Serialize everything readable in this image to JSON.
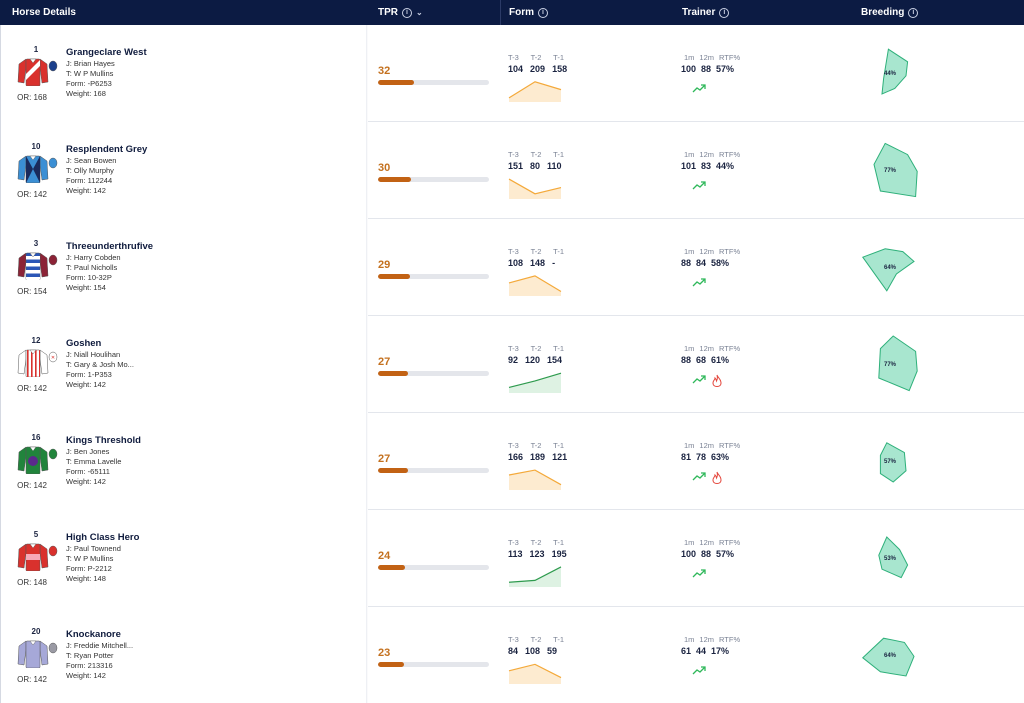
{
  "header": {
    "horse_details": "Horse Details",
    "tpr": "TPR",
    "form": "Form",
    "trainer": "Trainer",
    "breeding": "Breeding",
    "info_icon": "info-icon",
    "sort_icon": "chevron-down-icon"
  },
  "labels": {
    "form_t3": "T-3",
    "form_t2": "T-2",
    "form_t1": "T-1",
    "tr_1m": "1m",
    "tr_12m": "12m",
    "tr_rtf": "RTF%"
  },
  "colors": {
    "header_bg": "#0c1b43",
    "tpr_text": "#c4711f",
    "tpr_bar": "#c26214",
    "form_down": "#f4a93a",
    "form_up": "#2e9b4e",
    "trend": "#2fb85a",
    "hot": "#e4463c",
    "breeding_fill": "#a8e6cf",
    "breeding_stroke": "#2eb07a"
  },
  "horses": [
    {
      "number": "1",
      "name": "Grangeclare West",
      "jockey": "J: Brian Hayes",
      "trainer": "T: W P Mullins",
      "form_str": "Form: -P6253",
      "weight": "Weight: 168",
      "or": "OR: 168",
      "tpr": "32",
      "tpr_pct": 32,
      "form": {
        "t3": "104",
        "t2": "209",
        "t1": "158",
        "trend": "down",
        "series": [
          104,
          209,
          158
        ]
      },
      "trainer_stats": {
        "m1": "100",
        "m12": "88",
        "rtf": "57%",
        "hot": false
      },
      "breeding": {
        "pct": "44%",
        "shape": [
          [
            -0.05,
            -0.85
          ],
          [
            0.55,
            -0.4
          ],
          [
            0.5,
            0.1
          ],
          [
            0.15,
            0.55
          ],
          [
            -0.25,
            0.75
          ],
          [
            -0.2,
            0.2
          ]
        ]
      },
      "silks": {
        "body": "#d9312d",
        "sleeve": "#d9312d",
        "cap": "#1b3f8b",
        "pattern": "sash",
        "pattern_color": "#ffffff"
      }
    },
    {
      "number": "10",
      "name": "Resplendent Grey",
      "jockey": "J: Sean Bowen",
      "trainer": "T: Olly Murphy",
      "form_str": "Form: 112244",
      "weight": "Weight: 142",
      "or": "OR: 142",
      "tpr": "30",
      "tpr_pct": 30,
      "form": {
        "t3": "151",
        "t2": "80",
        "t1": "110",
        "trend": "down",
        "series": [
          151,
          80,
          110
        ]
      },
      "trainer_stats": {
        "m1": "101",
        "m12": "83",
        "rtf": "44%",
        "hot": false
      },
      "breeding": {
        "pct": "77%",
        "shape": [
          [
            -0.15,
            -0.95
          ],
          [
            0.55,
            -0.55
          ],
          [
            0.85,
            0.05
          ],
          [
            0.8,
            0.95
          ],
          [
            -0.3,
            0.75
          ],
          [
            -0.5,
            -0.2
          ]
        ]
      },
      "silks": {
        "body": "#3b8fd4",
        "sleeve": "#3b8fd4",
        "cap": "#3b8fd4",
        "pattern": "diamond",
        "pattern_color": "#1a2b5c"
      }
    },
    {
      "number": "3",
      "name": "Threeunderthrufive",
      "jockey": "J: Harry Cobden",
      "trainer": "T: Paul Nicholls",
      "form_str": "Form: 10-32P",
      "weight": "Weight: 154",
      "or": "OR: 154",
      "tpr": "29",
      "tpr_pct": 29,
      "form": {
        "t3": "108",
        "t2": "148",
        "t1": "-",
        "trend": "down",
        "series": [
          108,
          148,
          60
        ]
      },
      "trainer_stats": {
        "m1": "88",
        "m12": "84",
        "rtf": "58%",
        "hot": false
      },
      "breeding": {
        "pct": "64%",
        "shape": [
          [
            -0.85,
            -0.35
          ],
          [
            -0.15,
            -0.65
          ],
          [
            0.4,
            -0.55
          ],
          [
            0.75,
            -0.2
          ],
          [
            0.2,
            0.25
          ],
          [
            -0.1,
            0.85
          ]
        ]
      },
      "silks": {
        "body": "#2b56b7",
        "sleeve": "#8b2336",
        "cap": "#8b2336",
        "pattern": "hoops",
        "pattern_color": "#ffffff"
      }
    },
    {
      "number": "12",
      "name": "Goshen",
      "jockey": "J: Niall Houlihan",
      "trainer": "T: Gary & Josh Mo...",
      "form_str": "Form: 1-P353",
      "weight": "Weight: 142",
      "or": "OR: 142",
      "tpr": "27",
      "tpr_pct": 27,
      "form": {
        "t3": "92",
        "t2": "120",
        "t1": "154",
        "trend": "up",
        "series": [
          92,
          120,
          154
        ]
      },
      "trainer_stats": {
        "m1": "88",
        "m12": "68",
        "rtf": "61%",
        "hot": true
      },
      "breeding": {
        "pct": "77%",
        "shape": [
          [
            -0.3,
            -0.55
          ],
          [
            0.1,
            -1.0
          ],
          [
            0.8,
            -0.45
          ],
          [
            0.85,
            0.25
          ],
          [
            0.6,
            0.95
          ],
          [
            -0.35,
            0.5
          ]
        ]
      },
      "silks": {
        "body": "#ffffff",
        "sleeve": "#ffffff",
        "cap": "#ffffff",
        "pattern": "stripes",
        "pattern_color": "#d9312d"
      }
    },
    {
      "number": "16",
      "name": "Kings Threshold",
      "jockey": "J: Ben Jones",
      "trainer": "T: Emma Lavelle",
      "form_str": "Form: -65111",
      "weight": "Weight: 142",
      "or": "OR: 142",
      "tpr": "27",
      "tpr_pct": 27,
      "form": {
        "t3": "166",
        "t2": "189",
        "t1": "121",
        "trend": "down",
        "series": [
          166,
          189,
          121
        ]
      },
      "trainer_stats": {
        "m1": "81",
        "m12": "78",
        "rtf": "63%",
        "hot": true
      },
      "breeding": {
        "pct": "57%",
        "shape": [
          [
            -0.1,
            -0.65
          ],
          [
            0.45,
            -0.3
          ],
          [
            0.5,
            0.35
          ],
          [
            0.1,
            0.75
          ],
          [
            -0.3,
            0.45
          ],
          [
            -0.3,
            -0.2
          ]
        ]
      },
      "silks": {
        "body": "#21843c",
        "sleeve": "#21843c",
        "cap": "#21843c",
        "pattern": "ball",
        "pattern_color": "#5b2a8c"
      }
    },
    {
      "number": "5",
      "name": "High Class Hero",
      "jockey": "J: Paul Townend",
      "trainer": "T: W P Mullins",
      "form_str": "Form: P-2212",
      "weight": "Weight: 148",
      "or": "OR: 148",
      "tpr": "24",
      "tpr_pct": 24,
      "form": {
        "t3": "113",
        "t2": "123",
        "t1": "195",
        "trend": "up",
        "series": [
          113,
          123,
          195
        ]
      },
      "trainer_stats": {
        "m1": "100",
        "m12": "88",
        "rtf": "57%",
        "hot": false
      },
      "breeding": {
        "pct": "53%",
        "shape": [
          [
            -0.1,
            -0.75
          ],
          [
            0.3,
            -0.3
          ],
          [
            0.55,
            0.25
          ],
          [
            0.35,
            0.7
          ],
          [
            -0.25,
            0.4
          ],
          [
            -0.35,
            -0.1
          ]
        ]
      },
      "silks": {
        "body": "#d9312d",
        "sleeve": "#d9312d",
        "cap": "#d9312d",
        "pattern": "band",
        "pattern_color": "#f7a8b8"
      }
    },
    {
      "number": "20",
      "name": "Knockanore",
      "jockey": "J: Freddie Mitchell...",
      "trainer": "T: Ryan Potter",
      "form_str": "Form: 213316",
      "weight": "Weight: 142",
      "or": "OR: 142",
      "tpr": "23",
      "tpr_pct": 23,
      "form": {
        "t3": "84",
        "t2": "108",
        "t1": "59",
        "trend": "down",
        "series": [
          84,
          108,
          59
        ]
      },
      "trainer_stats": {
        "m1": "61",
        "m12": "44",
        "rtf": "17%",
        "hot": false
      },
      "breeding": {
        "pct": "64%",
        "shape": [
          [
            -0.85,
            0.1
          ],
          [
            -0.2,
            -0.6
          ],
          [
            0.45,
            -0.45
          ],
          [
            0.75,
            0.05
          ],
          [
            0.5,
            0.75
          ],
          [
            -0.3,
            0.6
          ]
        ]
      },
      "silks": {
        "body": "#a6a8d8",
        "sleeve": "#a6a8d8",
        "cap": "#9a9aa4",
        "pattern": "plain",
        "pattern_color": "#a6a8d8"
      }
    }
  ]
}
